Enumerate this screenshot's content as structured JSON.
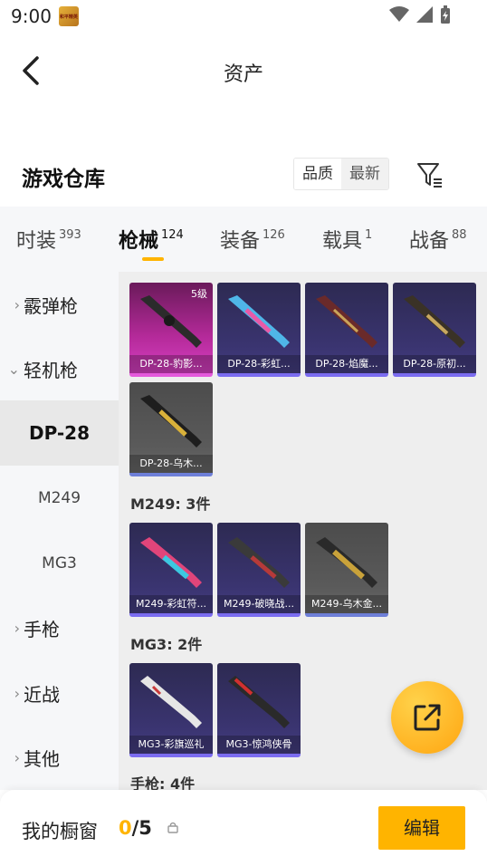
{
  "status_bar": {
    "time": "9:00",
    "app_icon_text": "和平精英"
  },
  "header": {
    "title": "资产"
  },
  "section": {
    "title": "游戏仓库",
    "sort_options": [
      "品质",
      "最新"
    ]
  },
  "tabs": [
    {
      "label": "时装",
      "count": "393"
    },
    {
      "label": "枪械",
      "count": "124"
    },
    {
      "label": "装备",
      "count": "126"
    },
    {
      "label": "载具",
      "count": "1"
    },
    {
      "label": "战备",
      "count": "88"
    }
  ],
  "sidebar": {
    "items": [
      {
        "label": "霰弹枪"
      },
      {
        "label": "轻机枪"
      },
      {
        "label": "DP-28"
      },
      {
        "label": "M249"
      },
      {
        "label": "MG3"
      },
      {
        "label": "手枪"
      },
      {
        "label": "近战"
      },
      {
        "label": "其他"
      }
    ]
  },
  "groups": {
    "dp28": {
      "items": [
        {
          "name": "DP-28-豹影...",
          "level": "5级"
        },
        {
          "name": "DP-28-彩虹..."
        },
        {
          "name": "DP-28-焰魔..."
        },
        {
          "name": "DP-28-原初..."
        },
        {
          "name": "DP-28-乌木..."
        }
      ]
    },
    "m249": {
      "title": "M249: 3件",
      "items": [
        {
          "name": "M249-彩虹符..."
        },
        {
          "name": "M249-破晓战..."
        },
        {
          "name": "M249-乌木金..."
        }
      ]
    },
    "mg3": {
      "title": "MG3: 2件",
      "items": [
        {
          "name": "MG3-彩旗巡礼"
        },
        {
          "name": "MG3-惊鸿侠骨"
        }
      ]
    },
    "pistol": {
      "title": "手枪: 4件"
    }
  },
  "bottom_bar": {
    "label": "我的橱窗",
    "count_current": "0",
    "count_total": "/5",
    "edit_label": "编辑"
  },
  "colors": {
    "accent": "#ffb400",
    "card_purple": "#3a3470",
    "card_pink": "#b52a9a",
    "card_gray": "#5a5a5a"
  }
}
